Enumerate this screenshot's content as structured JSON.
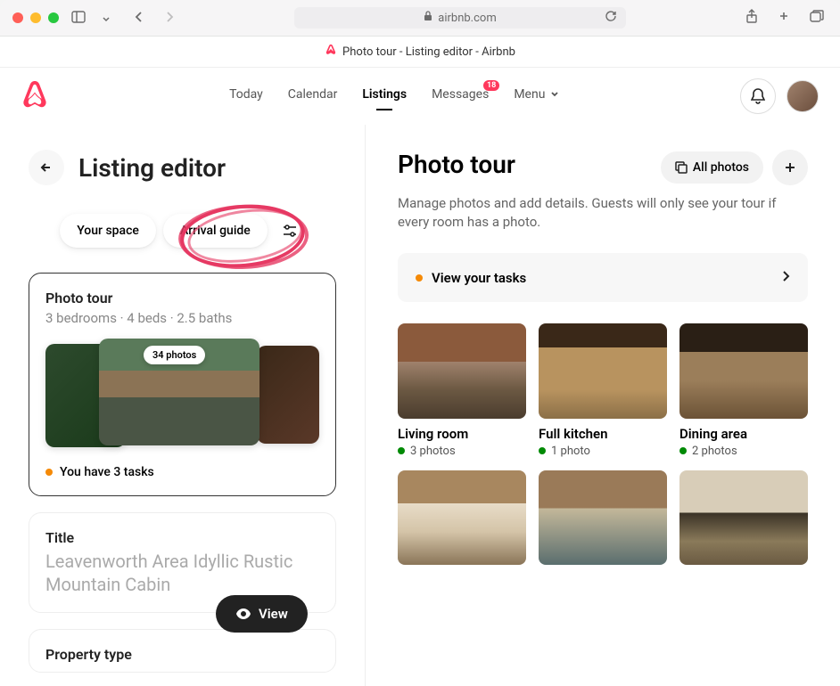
{
  "browser": {
    "url_display": "airbnb.com",
    "tab_title": "Photo tour - Listing editor - Airbnb"
  },
  "nav": {
    "items": [
      "Today",
      "Calendar",
      "Listings",
      "Messages",
      "Menu"
    ],
    "active_index": 2,
    "messages_badge": "18"
  },
  "left": {
    "title": "Listing editor",
    "tabs": {
      "your_space": "Your space",
      "arrival_guide": "Arrival guide"
    },
    "photo_tour_card": {
      "title": "Photo tour",
      "subtitle": "3 bedrooms · 4 beds · 2.5 baths",
      "photo_count_chip": "34 photos",
      "tasks_text": "You have 3 tasks"
    },
    "title_card": {
      "label": "Title",
      "value": "Leavenworth Area Idyllic Rustic Mountain Cabin"
    },
    "property_type_label": "Property type",
    "view_button": "View"
  },
  "right": {
    "title": "Photo tour",
    "all_photos": "All photos",
    "description": "Manage photos and add details. Guests will only see your tour if every room has a photo.",
    "tasks_bar": "View your tasks",
    "rooms": [
      {
        "name": "Living room",
        "count": "3 photos",
        "img": "img-living"
      },
      {
        "name": "Full kitchen",
        "count": "1 photo",
        "img": "img-kitchen"
      },
      {
        "name": "Dining area",
        "count": "2 photos",
        "img": "img-dining"
      },
      {
        "name": "",
        "count": "",
        "img": "img-bed1"
      },
      {
        "name": "",
        "count": "",
        "img": "img-bed2"
      },
      {
        "name": "",
        "count": "",
        "img": "img-bed3"
      }
    ]
  },
  "colors": {
    "accent": "#ff385c"
  }
}
